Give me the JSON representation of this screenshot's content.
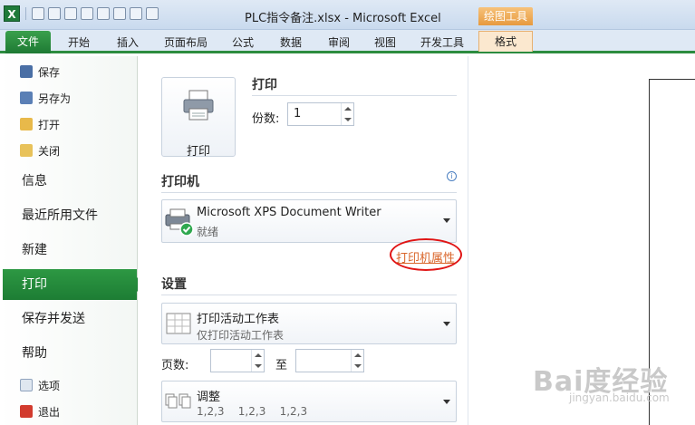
{
  "titlebar": {
    "title": "PLC指令备注.xlsx  -  Microsoft Excel",
    "context_group": "绘图工具",
    "logo": "X"
  },
  "tabs": [
    {
      "label": "文件"
    },
    {
      "label": "开始"
    },
    {
      "label": "插入"
    },
    {
      "label": "页面布局"
    },
    {
      "label": "公式"
    },
    {
      "label": "数据"
    },
    {
      "label": "审阅"
    },
    {
      "label": "视图"
    },
    {
      "label": "开发工具"
    },
    {
      "label": "格式"
    }
  ],
  "backstage": {
    "commands": [
      {
        "label": "保存",
        "icon": "save-icon"
      },
      {
        "label": "另存为",
        "icon": "save-as-icon"
      },
      {
        "label": "打开",
        "icon": "open-folder-icon"
      },
      {
        "label": "关闭",
        "icon": "close-folder-icon"
      }
    ],
    "nav": [
      {
        "label": "信息"
      },
      {
        "label": "最近所用文件"
      },
      {
        "label": "新建"
      },
      {
        "label": "打印"
      },
      {
        "label": "保存并发送"
      },
      {
        "label": "帮助"
      }
    ],
    "footer_commands": [
      {
        "label": "选项",
        "icon": "options-icon"
      },
      {
        "label": "退出",
        "icon": "exit-icon"
      }
    ]
  },
  "print": {
    "section_title": "打印",
    "button_label": "打印",
    "copies_label": "份数:",
    "copies_value": "1"
  },
  "printer": {
    "section_title": "打印机",
    "name": "Microsoft XPS Document Writer",
    "status": "就绪",
    "properties_link": "打印机属性",
    "info_glyph": "i"
  },
  "settings": {
    "section_title": "设置",
    "scope_title": "打印活动工作表",
    "scope_sub": "仅打印活动工作表",
    "pages_label": "页数:",
    "to_label": "至",
    "collate_title": "调整",
    "collate_sub": "1,2,3    1,2,3    1,2,3"
  },
  "watermark": {
    "brand": "Bai度经验",
    "url": "jingyan.baidu.com"
  }
}
